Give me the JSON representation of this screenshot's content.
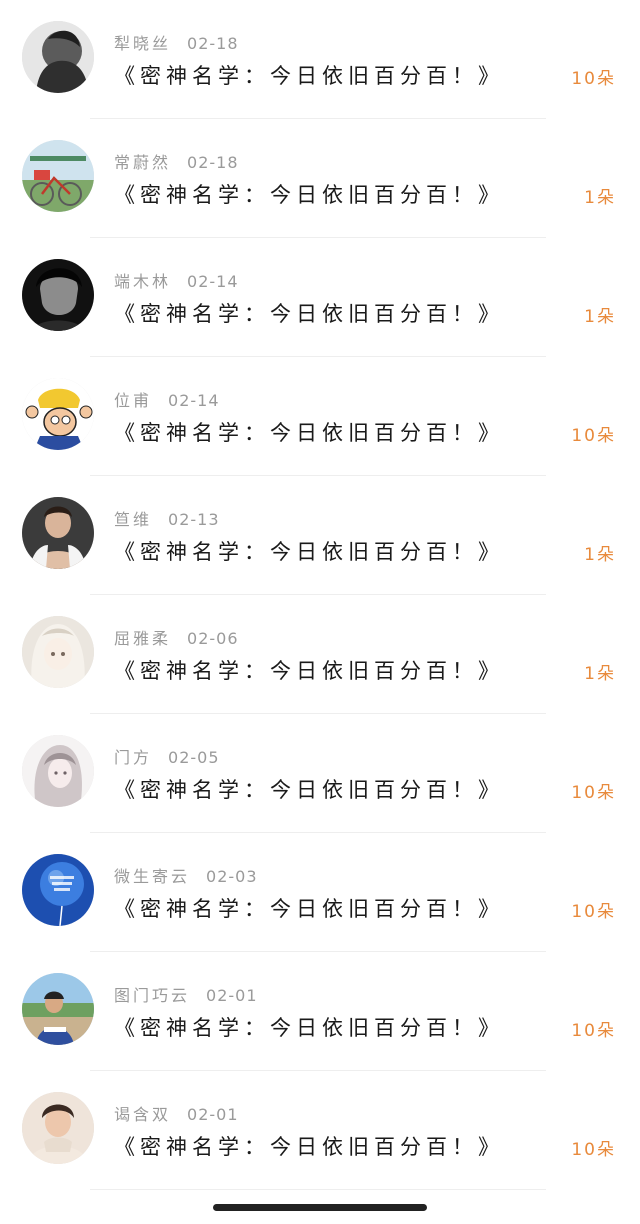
{
  "gift_records": [
    {
      "name": "犁晓丝",
      "date": "02-18",
      "message": "《密神名学：今日依旧百分百！》",
      "gift_count": "10朵",
      "avatar": "grayscale-portrait"
    },
    {
      "name": "常蔚然",
      "date": "02-18",
      "message": "《密神名学：今日依旧百分百！》",
      "gift_count": "1朵",
      "avatar": "bicycle-photo"
    },
    {
      "name": "端木林",
      "date": "02-14",
      "message": "《密神名学：今日依旧百分百！》",
      "gift_count": "1朵",
      "avatar": "bw-man-portrait"
    },
    {
      "name": "位甫",
      "date": "02-14",
      "message": "《密神名学：今日依旧百分百！》",
      "gift_count": "10朵",
      "avatar": "cartoon-character"
    },
    {
      "name": "笪维",
      "date": "02-13",
      "message": "《密神名学：今日依旧百分百！》",
      "gift_count": "1朵",
      "avatar": "man-portrait"
    },
    {
      "name": "屈雅柔",
      "date": "02-06",
      "message": "《密神名学：今日依旧百分百！》",
      "gift_count": "1朵",
      "avatar": "anime-girl-light"
    },
    {
      "name": "门方",
      "date": "02-05",
      "message": "《密神名学：今日依旧百分百！》",
      "gift_count": "10朵",
      "avatar": "anime-girl-sketch"
    },
    {
      "name": "微生寄云",
      "date": "02-03",
      "message": "《密神名学：今日依旧百分百！》",
      "gift_count": "10朵",
      "avatar": "blue-balloon"
    },
    {
      "name": "图门巧云",
      "date": "02-01",
      "message": "《密神名学：今日依旧百分百！》",
      "gift_count": "10朵",
      "avatar": "outdoor-boy"
    },
    {
      "name": "谒含双",
      "date": "02-01",
      "message": "《密神名学：今日依旧百分百！》",
      "gift_count": "10朵",
      "avatar": "boy-sweater"
    }
  ],
  "colors": {
    "gift_count": "#e88a3c",
    "meta_text": "#9a9a9a",
    "message_text": "#1a1a1a",
    "divider": "#eeeeee"
  }
}
